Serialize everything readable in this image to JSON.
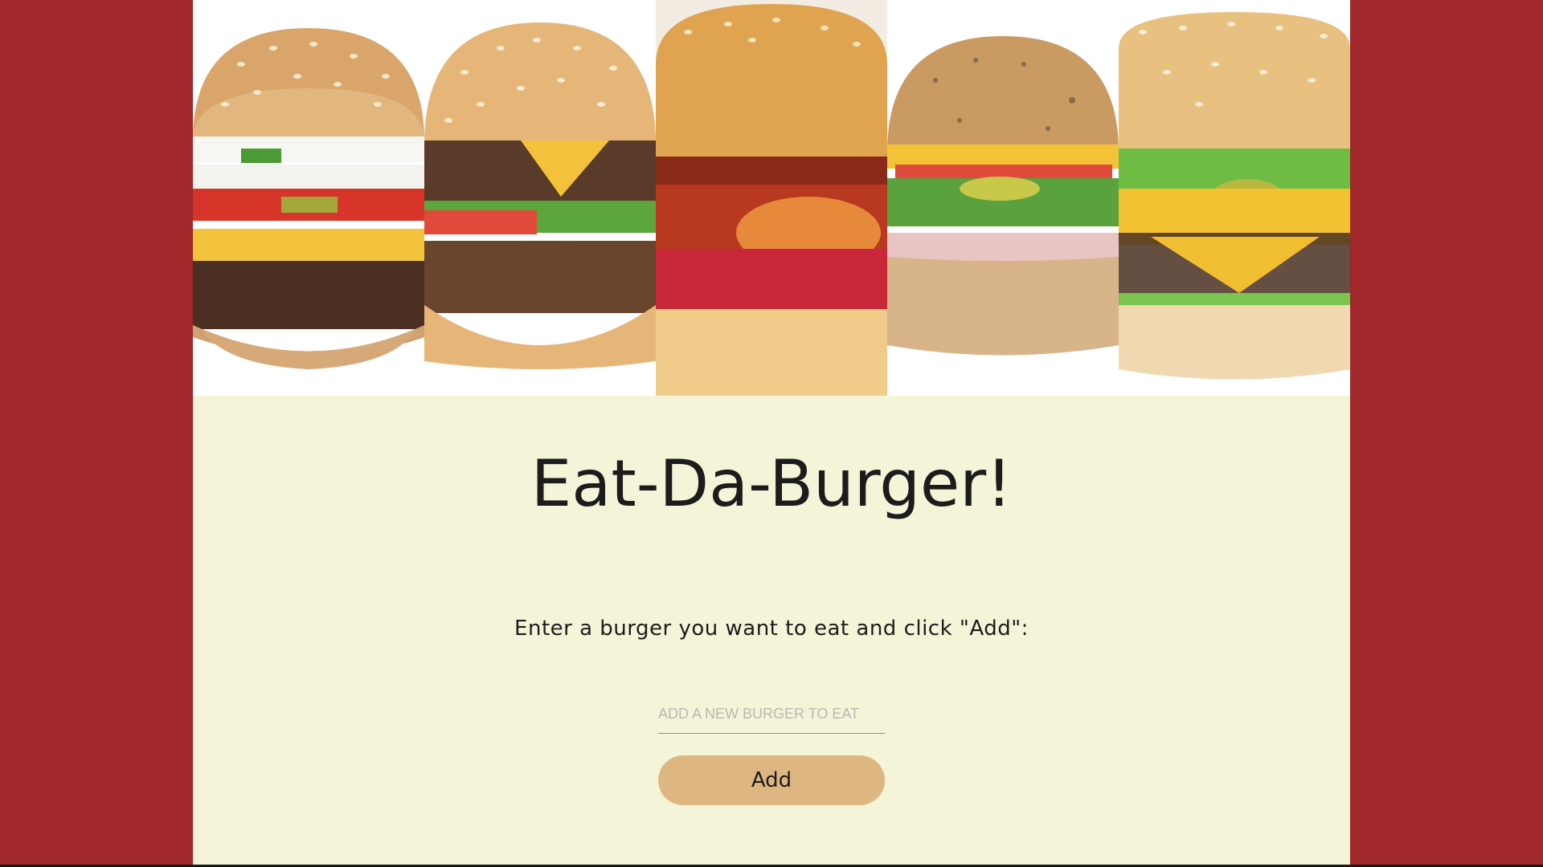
{
  "header": {
    "burgers": [
      {
        "name": "sesame-burger-icon"
      },
      {
        "name": "cheeseburger-icon"
      },
      {
        "name": "bacon-burger-icon"
      },
      {
        "name": "ham-burger-icon"
      },
      {
        "name": "lettuce-cheeseburger-icon"
      }
    ]
  },
  "main": {
    "title": "Eat-Da-Burger!",
    "instructions": "Enter a burger you want to eat and click \"Add\":",
    "input_placeholder": "ADD A NEW BURGER TO EAT",
    "input_value": "",
    "add_label": "Add"
  },
  "colors": {
    "outer_background": "#a0282a",
    "page_background": "#f4f4d9",
    "button_background": "#deb682"
  }
}
